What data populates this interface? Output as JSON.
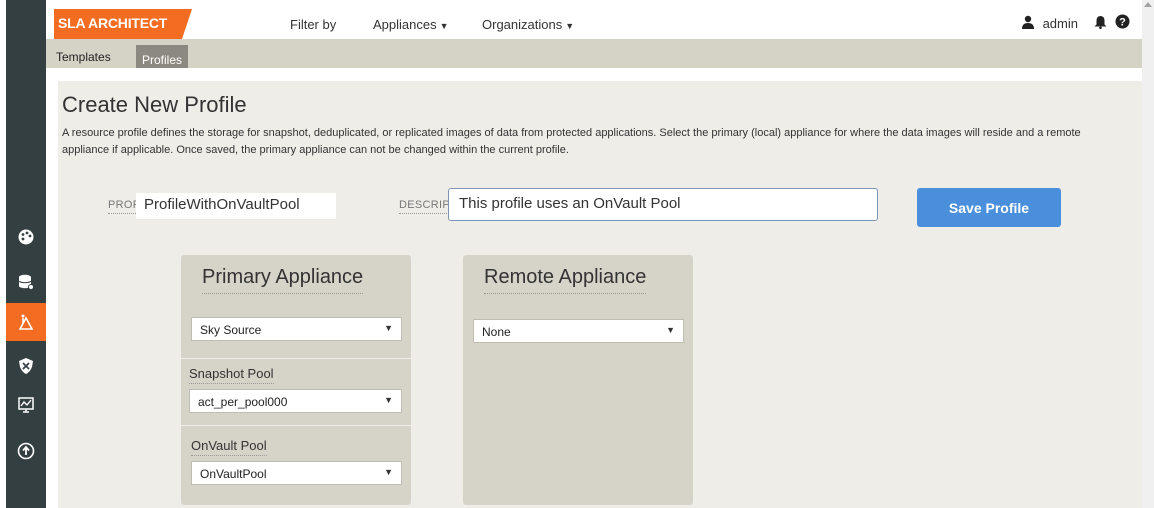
{
  "topbar": {
    "brand": "SLA ARCHITECT",
    "filter_by": "Filter by",
    "appliances": "Appliances",
    "organizations": "Organizations",
    "user": "admin"
  },
  "tabs": [
    {
      "label": "Templates",
      "active": false
    },
    {
      "label": "Profiles",
      "active": true
    }
  ],
  "sidebar": {
    "items": [
      {
        "icon": "dashboard-icon"
      },
      {
        "icon": "database-gear-icon"
      },
      {
        "icon": "sla-architect-icon",
        "active": true
      },
      {
        "icon": "shield-icon"
      },
      {
        "icon": "monitor-chart-icon"
      },
      {
        "icon": "upload-circle-icon"
      }
    ]
  },
  "form": {
    "heading": "Create New Profile",
    "description": "A resource profile defines the storage for snapshot, deduplicated, or replicated images of data from protected applications. Select the primary (local) appliance for where the data images will reside and a remote appliance if applicable. Once saved, the primary appliance can not be changed within the current profile.",
    "profile_label": "PROFILE",
    "profile_required": "*",
    "profile_value": "ProfileWithOnVaultPool",
    "description_label": "DESCRIPTION",
    "description_value": "This profile uses an OnVault Pool",
    "save_label": "Save Profile"
  },
  "primary": {
    "title": "Primary Appliance",
    "appliance": "Sky Source",
    "snapshot_label": "Snapshot Pool",
    "snapshot_value": "act_per_pool000",
    "onvault_label": "OnVault Pool",
    "onvault_value": "OnVaultPool"
  },
  "remote": {
    "title": "Remote Appliance",
    "appliance": "None"
  },
  "colors": {
    "accent": "#f36c21",
    "sidebar": "#343f41",
    "button": "#4a8fdc"
  }
}
